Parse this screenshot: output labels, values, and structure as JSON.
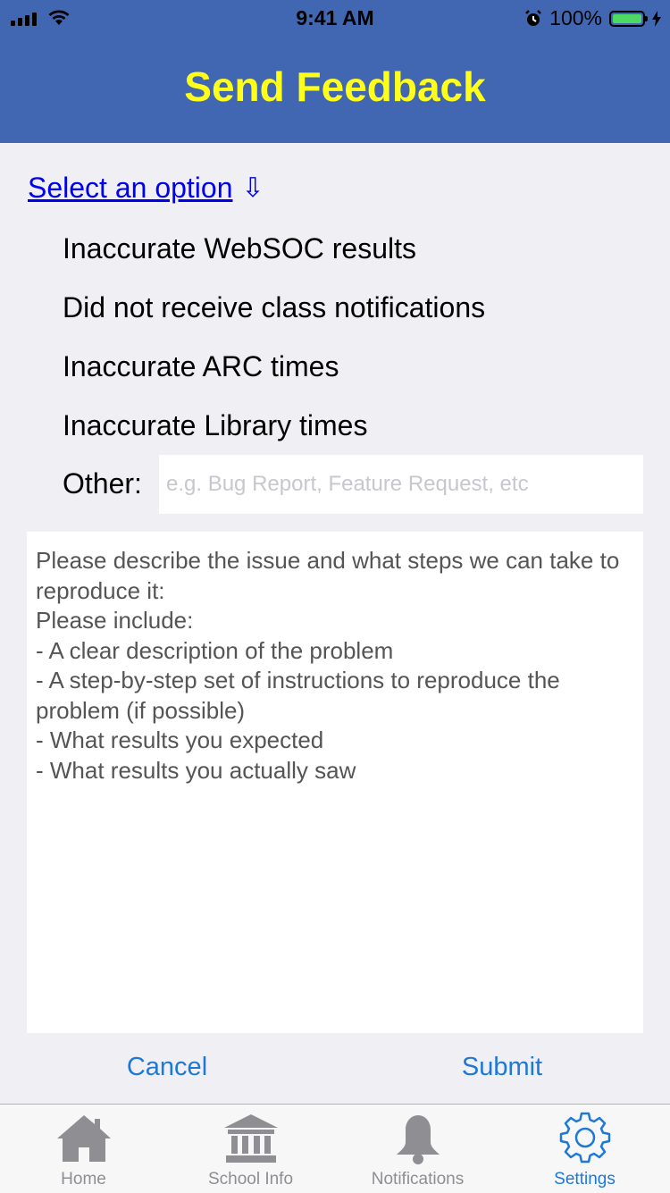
{
  "status_bar": {
    "time": "9:41 AM",
    "battery": "100%",
    "icons": [
      "signal-icon",
      "wifi-icon",
      "alarm-icon",
      "battery-icon",
      "charging-icon"
    ]
  },
  "header": {
    "title": "Send Feedback"
  },
  "select": {
    "label": "Select an option",
    "arrow": "⇩"
  },
  "options": [
    "Inaccurate WebSOC results",
    "Did not receive class notifications",
    "Inaccurate ARC times",
    "Inaccurate Library times"
  ],
  "other": {
    "label": "Other:",
    "placeholder": "e.g. Bug Report, Feature Request, etc",
    "value": ""
  },
  "description": {
    "text": "Please describe the issue and what steps we can take to reproduce it:\nPlease include:\n- A clear description of the problem\n- A step-by-step set of instructions to reproduce the problem (if possible)\n- What results you expected\n- What results you actually saw"
  },
  "actions": {
    "cancel": "Cancel",
    "submit": "Submit"
  },
  "tabs": [
    {
      "label": "Home",
      "icon": "home-icon",
      "active": false
    },
    {
      "label": "School Info",
      "icon": "school-icon",
      "active": false
    },
    {
      "label": "Notifications",
      "icon": "bell-icon",
      "active": false
    },
    {
      "label": "Settings",
      "icon": "gear-icon",
      "active": true
    }
  ],
  "colors": {
    "header_bg": "#4267b2",
    "title": "#ffff1a",
    "link": "#0000ee",
    "accent": "#1e78d7",
    "inactive_tab": "#8e8e93"
  }
}
